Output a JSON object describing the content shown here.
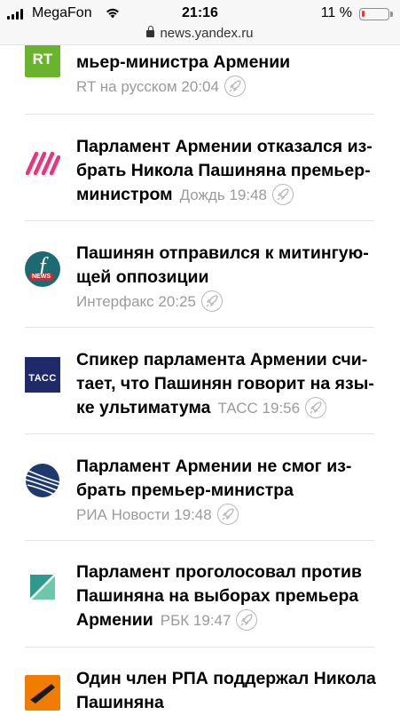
{
  "status": {
    "carrier": "MegaFon",
    "time": "21:16",
    "battery_pct": "11 %",
    "battery_level": 0.11,
    "url": "news.yandex.ru"
  },
  "items": [
    {
      "title_tail": "мьер-министра Армении",
      "source": "RT на русском",
      "time": "20:04",
      "logo": "rt-logo"
    },
    {
      "title_lines": [
        "Парламент Армении отказался из-",
        "брать Никола Пашиняна премьер-",
        "министром"
      ],
      "source": "Дождь",
      "time": "19:48",
      "logo": "dozhd-logo"
    },
    {
      "title_lines": [
        "Пашинян отправился к митингую-",
        "щей оппозиции"
      ],
      "source": "Интерфакс",
      "time": "20:25",
      "logo": "interfax-logo"
    },
    {
      "title_lines": [
        "Спикер парламента Армении счи-",
        "тает, что Пашинян говорит на язы-",
        "ке ультиматума"
      ],
      "source": "ТАСС",
      "time": "19:56",
      "logo": "tass-logo"
    },
    {
      "title_lines": [
        "Парламент Армении не смог из-",
        "брать премьер-министра"
      ],
      "source": "РИА Новости",
      "time": "19:48",
      "logo": "ria-logo"
    },
    {
      "title_lines": [
        "Парламент проголосовал против",
        "Пашиняна на выборах премьера",
        "Армении"
      ],
      "source": "РБК",
      "time": "19:47",
      "logo": "rbc-logo"
    },
    {
      "title_lines": [
        "Один член РПА поддержал Никола",
        "Пашиняна"
      ],
      "logo": "sputnik-logo"
    }
  ],
  "logos": {
    "rt": "RT",
    "tass": "ТАСС",
    "interfax_news": "NEWS"
  },
  "colors": {
    "rt": "#6ab42d",
    "dozhd": "#f0317e",
    "interfax": "#1c6b73",
    "tass": "#1f2a6b",
    "ria": "#1e3a6d",
    "rbc": "#2e9a8e",
    "sputnik": "#f07d00"
  }
}
